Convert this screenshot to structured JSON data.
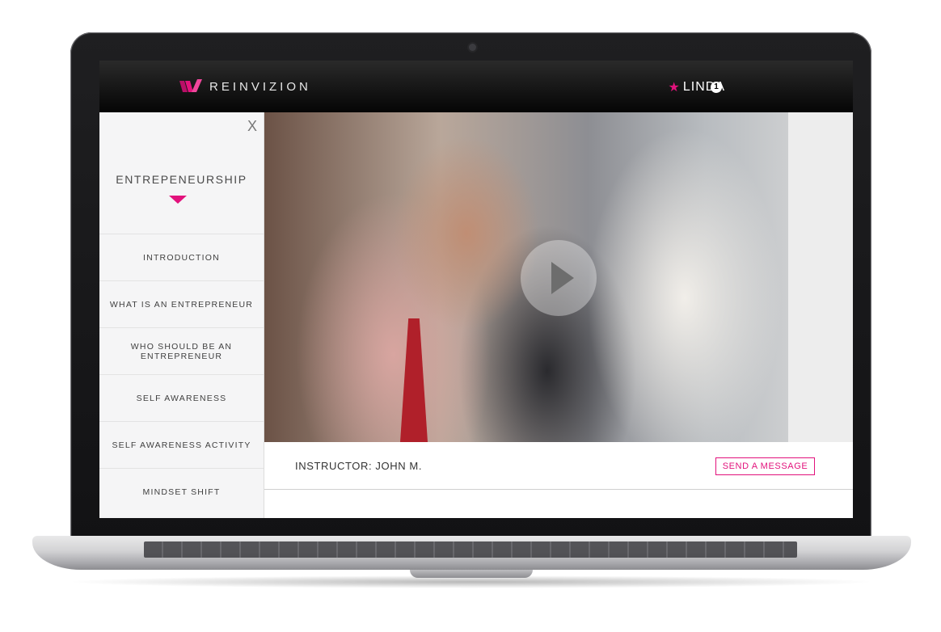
{
  "header": {
    "brand": "REINVIZION",
    "user_name": "LINDA",
    "notification_count": "1",
    "accent_color": "#e2127c"
  },
  "sidebar": {
    "close_label": "X",
    "course_title": "ENTREPENEURSHIP",
    "items": [
      {
        "label": "INTRODUCTION"
      },
      {
        "label": "WHAT IS AN ENTREPRENEUR"
      },
      {
        "label": "WHO SHOULD BE AN ENTREPRENEUR"
      },
      {
        "label": "SELF AWARENESS"
      },
      {
        "label": "SELF AWARENESS ACTIVITY"
      },
      {
        "label": "MINDSET SHIFT"
      }
    ]
  },
  "main": {
    "instructor_label": "INSTRUCTOR: JOHN M.",
    "send_message_label": "SEND A MESSAGE"
  }
}
